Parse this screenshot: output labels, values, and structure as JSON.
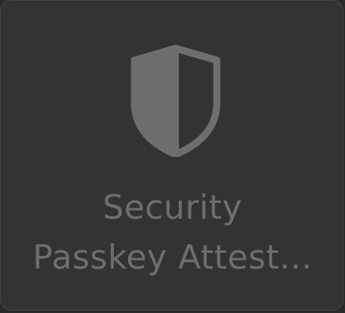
{
  "tile": {
    "title_line1": "Security",
    "title_line2": "Passkey Attest...",
    "icon": "shield-half-filled-icon"
  },
  "colors": {
    "tile_background": "#333333",
    "tile_border": "#474747",
    "icon": "#6e6e6e",
    "text": "#6e6e6e"
  }
}
